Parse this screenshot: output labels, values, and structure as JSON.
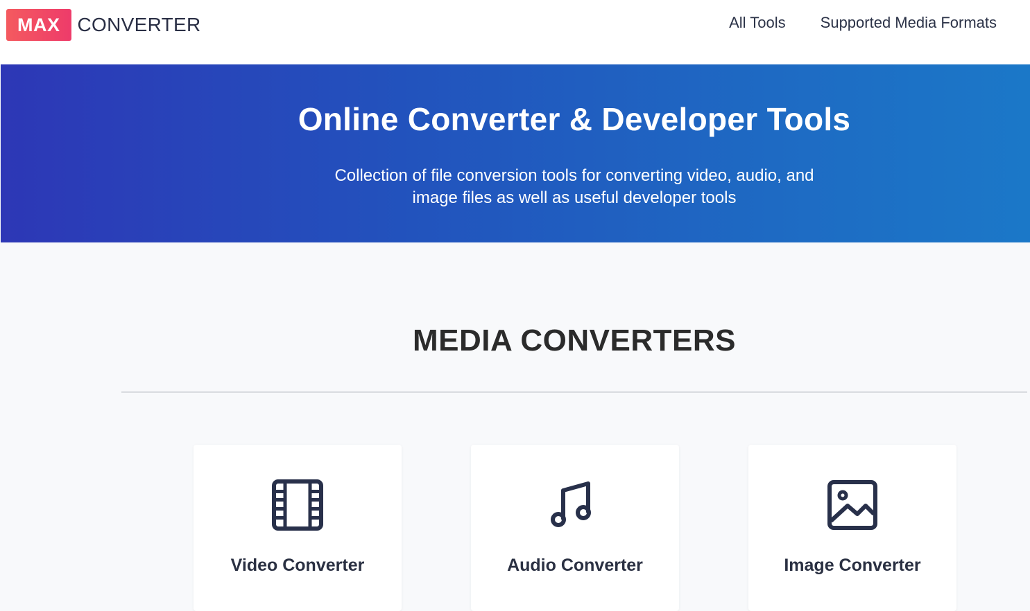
{
  "header": {
    "logo_badge": "MAX",
    "logo_text": "CONVERTER",
    "nav": [
      {
        "label": "All Tools"
      },
      {
        "label": "Supported Media Formats"
      }
    ]
  },
  "hero": {
    "title": "Online Converter & Developer Tools",
    "subtitle_line1": "Collection of file conversion tools for converting video, audio, and",
    "subtitle_line2": "image files as well as useful developer tools"
  },
  "section": {
    "title": "MEDIA CONVERTERS"
  },
  "cards": [
    {
      "label": "Video Converter",
      "icon": "film-icon"
    },
    {
      "label": "Audio Converter",
      "icon": "music-note-icon"
    },
    {
      "label": "Image Converter",
      "icon": "image-icon"
    }
  ],
  "colors": {
    "brand_red": "#f04862",
    "hero_start": "#2d37b6",
    "hero_end": "#1b78c8",
    "icon": "#28304a"
  }
}
